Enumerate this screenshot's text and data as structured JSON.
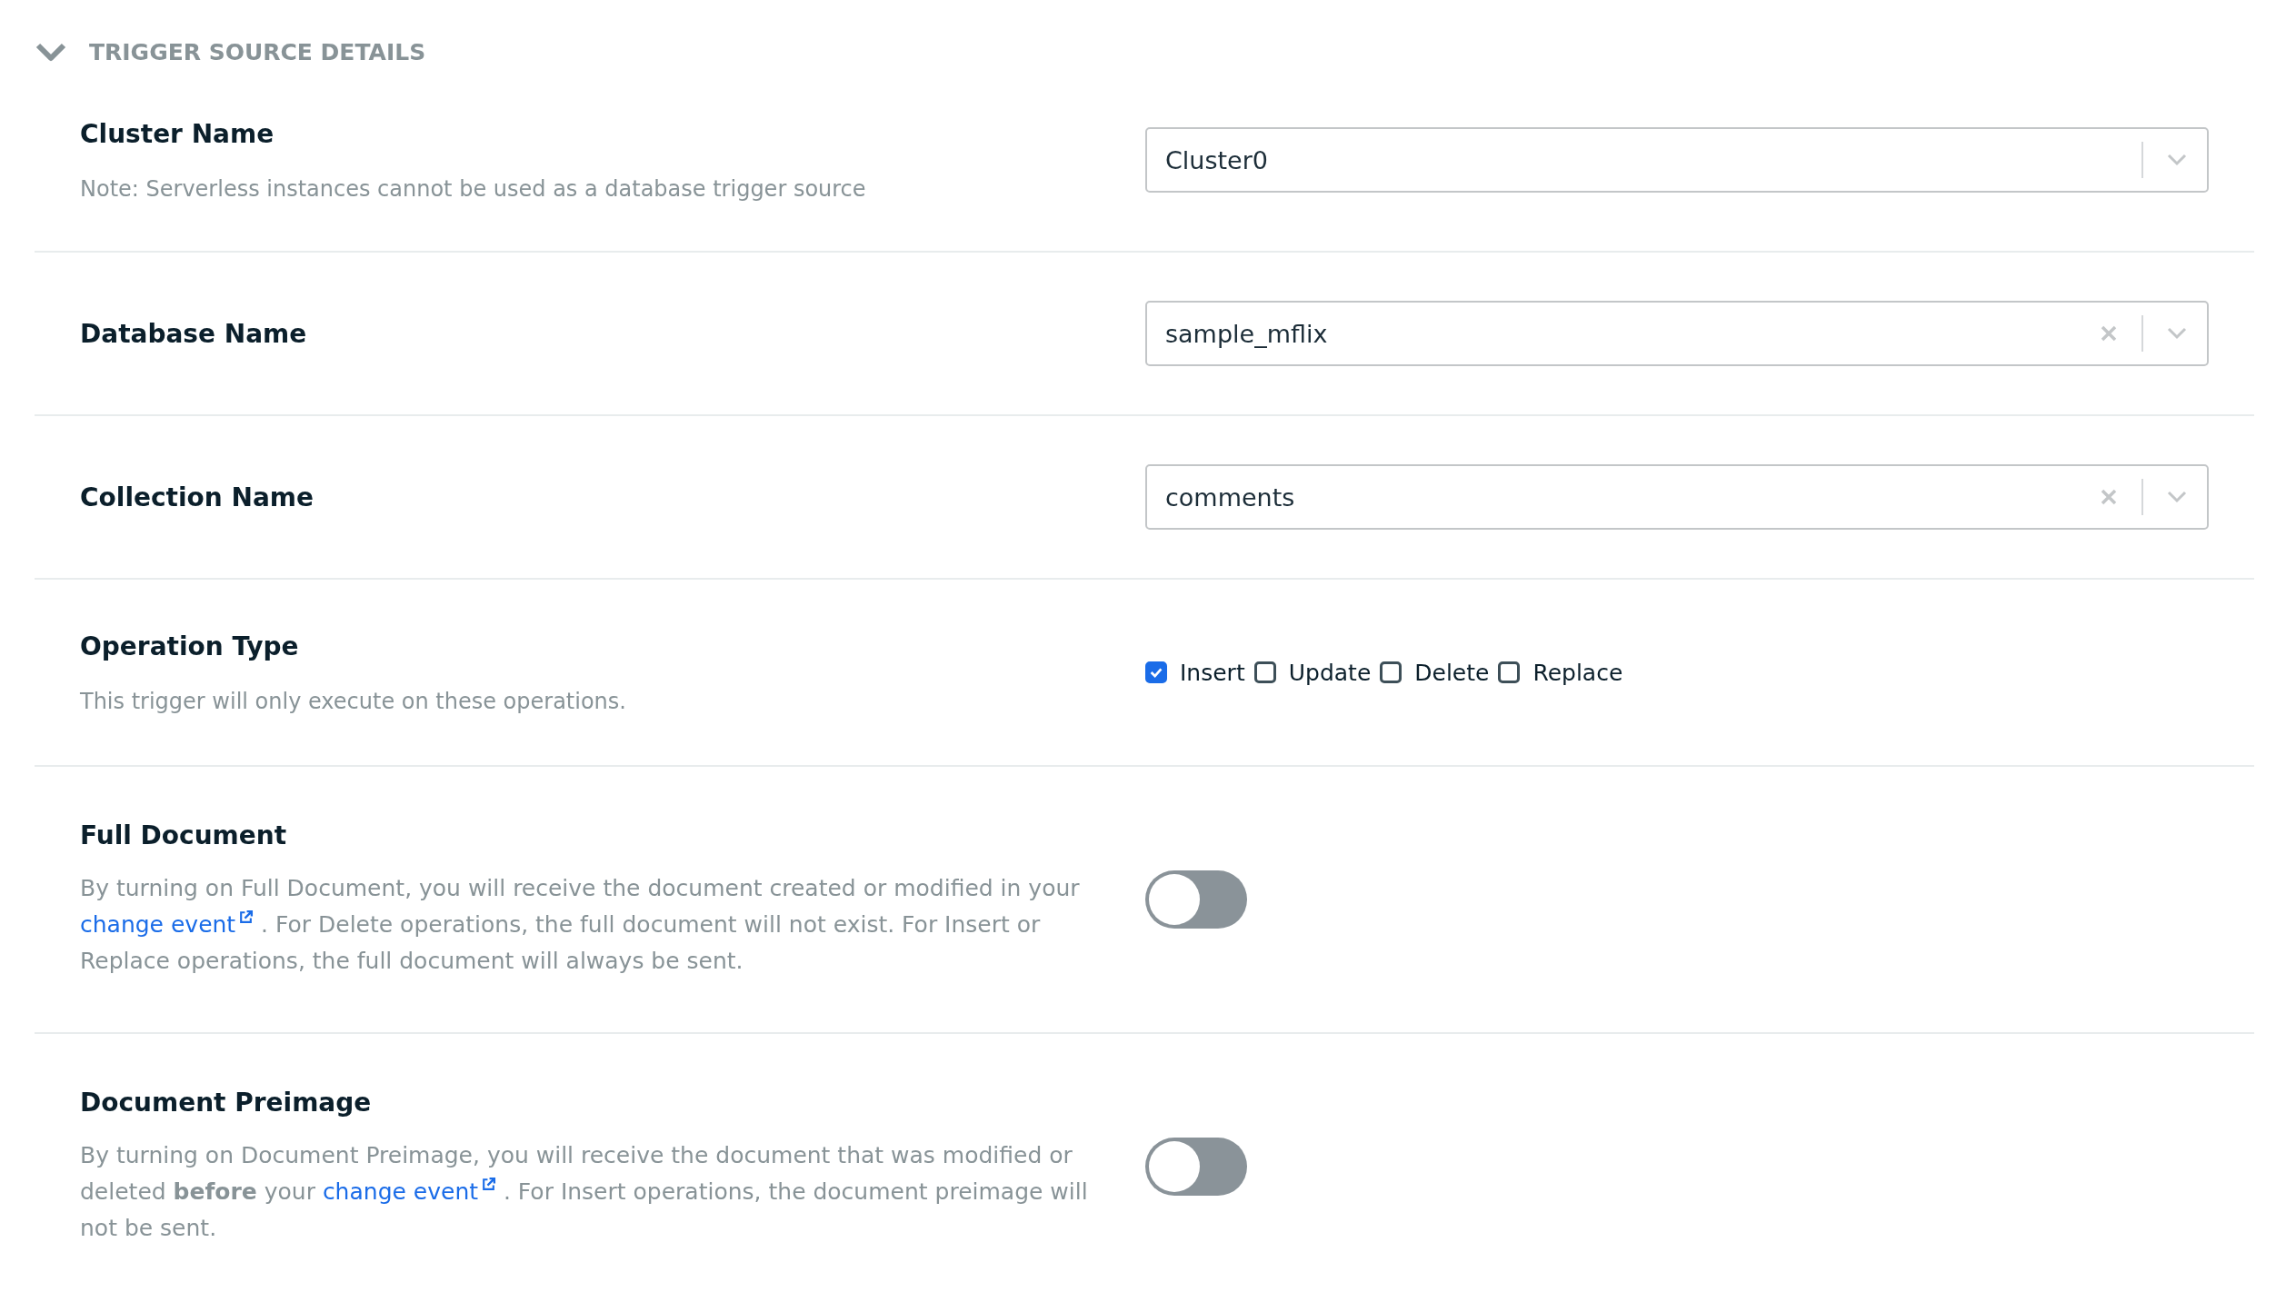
{
  "section": {
    "title": "TRIGGER SOURCE DETAILS",
    "expanded": true
  },
  "rows": [
    {
      "kind": "select",
      "label": "Cluster Name",
      "note": "Note: Serverless instances cannot be used as a database trigger source",
      "value": "Cluster0",
      "clearable": false
    },
    {
      "kind": "select",
      "label": "Database Name",
      "value": "sample_mflix",
      "clearable": true
    },
    {
      "kind": "select",
      "label": "Collection Name",
      "value": "comments",
      "clearable": true
    },
    {
      "kind": "checkboxes",
      "label": "Operation Type",
      "note": "This trigger will only execute on these operations.",
      "options": [
        {
          "label": "Insert",
          "checked": true
        },
        {
          "label": "Update",
          "checked": false
        },
        {
          "label": "Delete",
          "checked": false
        },
        {
          "label": "Replace",
          "checked": false
        }
      ]
    },
    {
      "kind": "toggle",
      "label": "Full Document",
      "on": false,
      "description": [
        {
          "kind": "text",
          "text": "By turning on Full Document, you will receive the document created or modified in your "
        },
        {
          "kind": "link",
          "text": "change event"
        },
        {
          "kind": "text",
          "text": " . For Delete operations, the full document will not exist. For Insert or Replace operations, the full document will always be sent."
        }
      ]
    },
    {
      "kind": "toggle",
      "label": "Document Preimage",
      "on": false,
      "description": [
        {
          "kind": "text",
          "text": "By turning on Document Preimage, you will receive the document that was modified or deleted **before** your "
        },
        {
          "kind": "link",
          "text": "change event"
        },
        {
          "kind": "text",
          "text": " . For Insert operations, the document preimage will not be sent."
        }
      ]
    }
  ]
}
